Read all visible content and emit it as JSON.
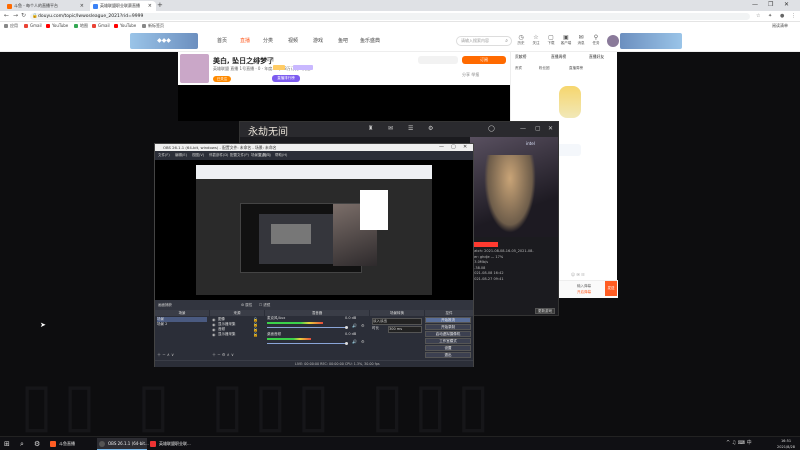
{
  "browser": {
    "tabs": [
      {
        "title": "斗鱼 - 每个人的直播平台",
        "active": false,
        "color": "#ff6a00"
      },
      {
        "title": "英雄联盟职业联赛直播",
        "active": true,
        "color": "#3b82f6"
      }
    ],
    "new_tab": "+",
    "window_controls": [
      "—",
      "❐",
      "✕"
    ],
    "url": "douyu.com/topic/lwwosleague_2021?rid=9999",
    "bookmarks": [
      {
        "label": "应用",
        "color": "#888"
      },
      {
        "label": "Gmail",
        "color": "#ea4335"
      },
      {
        "label": "YouTube",
        "color": "#ff0000"
      },
      {
        "label": "地图",
        "color": "#34a853"
      },
      {
        "label": "Gmail",
        "color": "#ea4335"
      },
      {
        "label": "YouTube",
        "color": "#ff0000"
      },
      {
        "label": "新标签页",
        "color": "#888"
      }
    ],
    "reading_list": "阅读清单"
  },
  "site": {
    "nav": [
      "首页",
      "直播",
      "分类",
      "视频",
      "游戏",
      "鱼吧",
      "鱼乐盛典"
    ],
    "active_nav": "直播",
    "search_placeholder": "请输入搜索内容",
    "header_icons": [
      {
        "glyph": "◷",
        "label": "历史"
      },
      {
        "glyph": "☆",
        "label": "关注"
      },
      {
        "glyph": "▢",
        "label": "下载"
      },
      {
        "glyph": "▣",
        "label": "客户端"
      },
      {
        "glyph": "✉",
        "label": "消息"
      },
      {
        "glyph": "⚲",
        "label": "任务"
      }
    ]
  },
  "room": {
    "title": "美白, 坠日之绯梦了",
    "tag": "英雄",
    "meta": "英雄联盟  直播 1号直播 · 0  · 年度人气  · 8万订阅  · 关注",
    "follow_button": "已关注",
    "rank_button": "直播排行榜",
    "subscribe_button": "订阅",
    "share": "分享  举报"
  },
  "chat": {
    "tabs": [
      "贡献榜",
      "直播周榜",
      "直播好友"
    ],
    "subtabs": [
      "贵宾",
      "粉丝团",
      "直播周榜"
    ],
    "input_hint": "输入弹幕",
    "input_hint2": "开启弹幕",
    "send": "发送",
    "icons": "☺ ✉ ☷"
  },
  "game": {
    "title": "永劫无间",
    "bar_icons": [
      "♜",
      "✉",
      "☰",
      "⚙",
      "◯",
      "—",
      "▢",
      "✕"
    ],
    "brand": "intel",
    "log": [
      "patch: 2021-08-08-16-05_2021-08-",
      "ver: ghdje — 17%",
      "73.0Mb/s",
      "2.38.08",
      "2021-08-08 16:42",
      "2021-08-27 09:41"
    ],
    "button": "更新游戏"
  },
  "obs": {
    "title": "OBS 26.1.1 (64-bit, windows) - 配置文件: 未命名 - 场景: 未命名",
    "menu": [
      "文件(F)",
      "编辑(E)",
      "视图(V)",
      "停靠部件(D)",
      "配置文件(P)",
      "场景集合(S)",
      "工具(T)",
      "帮助(H)"
    ],
    "control_bar": "画面捕获",
    "control_bar_items": [
      "⚙ 属性",
      "☐ 滤镜"
    ],
    "panels": [
      "场景",
      "来源",
      "混音器",
      "场景转换",
      "控件"
    ],
    "scenes": [
      "场景",
      "场景 2"
    ],
    "sources": [
      "图像",
      "显示器采集",
      "音频",
      "显示器采集"
    ],
    "mixer": [
      {
        "name": "麦克风/Aux",
        "db": "0.0 dB",
        "level": 0.7
      },
      {
        "name": "桌面音频",
        "db": "0.0 dB",
        "level": 0.55
      }
    ],
    "transition": {
      "label": "淡入淡出",
      "duration_label": "时长",
      "duration": "300 ms"
    },
    "controls": [
      "开始推流",
      "开始录制",
      "启动虚拟摄像机",
      "工作室模式",
      "设置",
      "退出"
    ],
    "statusbar": "LIVE: 00:00:00    REC: 00:00:00    CPU: 1.3%, 30.00 fps"
  },
  "taskbar": {
    "start_icon": "⊞",
    "search_icon": "⌕",
    "settings_icon": "⚙",
    "apps": [
      {
        "label": "斗鱼直播",
        "color": "#ff5d23",
        "active": false
      },
      {
        "label": "OBS 26.1.1 (64-bit...",
        "color": "#555",
        "active": true
      },
      {
        "label": "英雄联盟职业联...",
        "color": "#e33",
        "active": false
      }
    ],
    "tray": "^ ♫ ⌨ 中",
    "time": "16:51",
    "date": "2021/8/28"
  }
}
